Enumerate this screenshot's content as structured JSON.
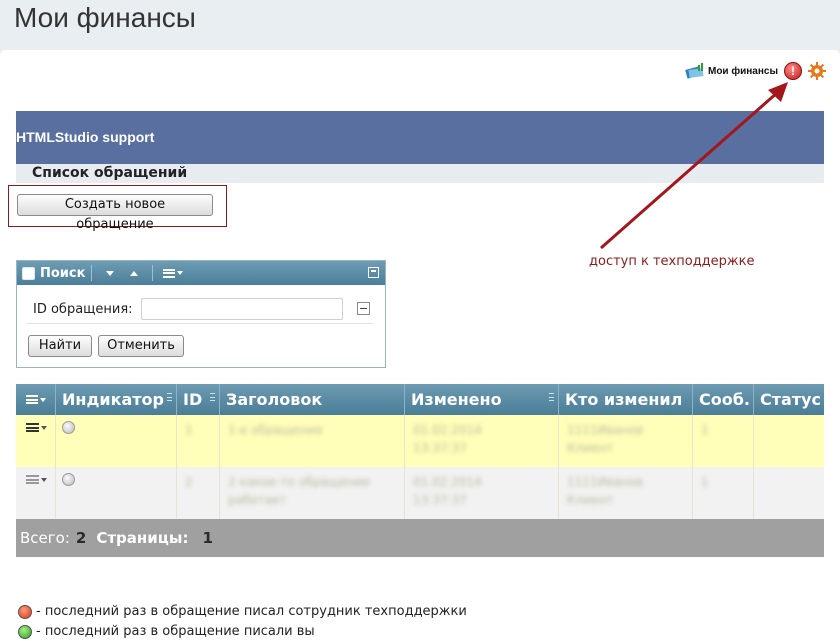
{
  "page": {
    "title": "Мои финансы"
  },
  "toplinks": {
    "money_label": "Мои финансы"
  },
  "support": {
    "title": "HTMLStudio support",
    "section": "Список обращений"
  },
  "create_button": "Создать новое обращение",
  "annotation": "доступ к техподдержке",
  "search": {
    "title": "Поиск",
    "field_label": "ID обращения:",
    "field_value": "",
    "find_button": "Найти",
    "cancel_button": "Отменить"
  },
  "grid": {
    "columns": [
      "Индикатор",
      "ID",
      "Заголовок",
      "Изменено",
      "Кто изменил",
      "Сооб.",
      "Статус"
    ],
    "rows": [
      {
        "id": "1",
        "title": "1-е обращение",
        "changed": "01.02.2014 13:37:37",
        "by": "1111Иванов Клиент",
        "msgs": "1",
        "status": ""
      },
      {
        "id": "2",
        "title": "2 какое-то обращение работает",
        "changed": "01.02.2014 13:37:37",
        "by": "1111Иванов Клиент",
        "msgs": "1",
        "status": ""
      }
    ],
    "footer": {
      "total_label": "Всего:",
      "total": "2",
      "pages_label": "Страницы:",
      "pages": "1"
    }
  },
  "legend": {
    "red": "- последний раз в обращение писал сотрудник техподдержки",
    "green": "- последний раз в обращение писали вы"
  },
  "colors": {
    "header_blue": "#586fa0",
    "grid_head": "#4a7d97",
    "highlight_row": "#ffffb9",
    "annotation_red": "#8c1a1a"
  }
}
